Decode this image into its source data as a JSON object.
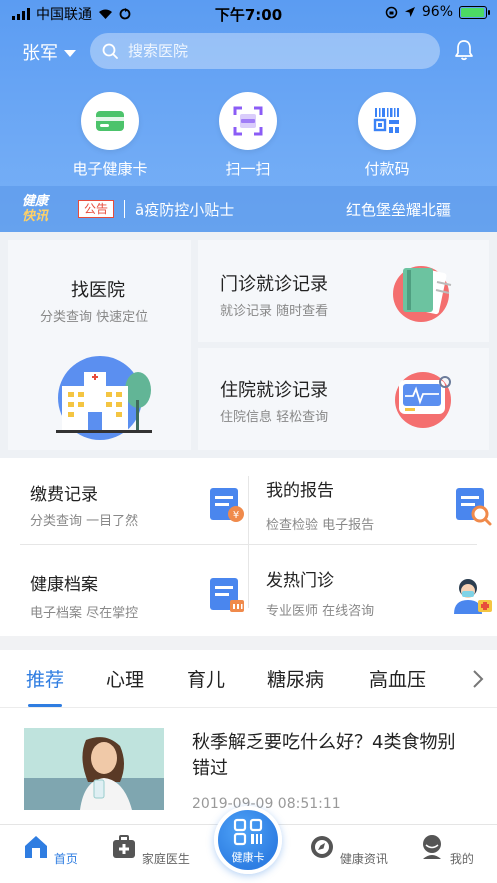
{
  "status_bar": {
    "carrier": "中国联通",
    "time": "下午7:00",
    "battery": "96%",
    "battery_level": 0.96
  },
  "header": {
    "user_name": "张军",
    "search_placeholder": "搜索医院"
  },
  "quick_actions": [
    {
      "label": "电子健康卡",
      "icon": "health-card-icon"
    },
    {
      "label": "扫一扫",
      "icon": "scan-icon"
    },
    {
      "label": "付款码",
      "icon": "payment-code-icon"
    }
  ],
  "news_bar": {
    "logo_line1": "健康",
    "logo_line2": "快讯",
    "tag": "公告",
    "text": "ā疫防控小贴士",
    "text2": "红色堡垒耀北疆"
  },
  "cards": {
    "find_hospital": {
      "title": "找医院",
      "subtitle": "分类查询 快速定位"
    },
    "outpatient": {
      "title": "门诊就诊记录",
      "subtitle": "就诊记录 随时查看"
    },
    "inpatient": {
      "title": "住院就诊记录",
      "subtitle": "住院信息 轻松查询"
    }
  },
  "grid": [
    {
      "title": "缴费记录",
      "subtitle": "分类查询 一目了然"
    },
    {
      "title": "我的报告",
      "subtitle": "检查检验 电子报告"
    },
    {
      "title": "健康档案",
      "subtitle": "电子档案 尽在掌控"
    },
    {
      "title": "发热门诊",
      "subtitle": "专业医师 在线咨询"
    }
  ],
  "tabs": [
    "推荐",
    "心理",
    "育儿",
    "糖尿病",
    "高血压"
  ],
  "article": {
    "title": "秋季解乏要吃什么好？4类食物别错过",
    "time": "2019-09-09 08:51:11"
  },
  "bottom_nav": {
    "home": "首页",
    "family_doctor": "家庭医生",
    "center": "健康卡",
    "health_news": "健康资讯",
    "mine": "我的"
  },
  "colors": {
    "primary": "#2f7de1",
    "hero": "#6ea9f5",
    "notice_red": "#e74c3c"
  }
}
